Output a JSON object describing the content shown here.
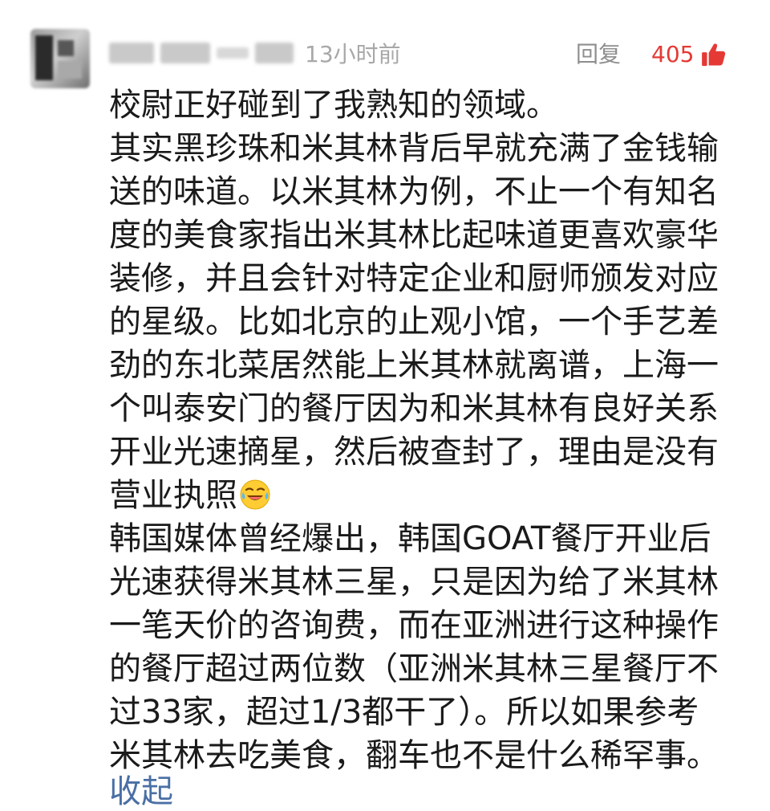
{
  "comment": {
    "time": "13小时前",
    "reply_label": "回复",
    "like_count": "405",
    "lines": [
      "校尉正好碰到了我熟知的领域。",
      "其实黑珍珠和米其林背后早就充满了金钱输",
      "送的味道。以米其林为例，不止一个有知名",
      "度的美食家指出米其林比起味道更喜欢豪华",
      "装修，并且会针对特定企业和厨师颁发对应",
      "的星级。比如北京的止观小馆，一个手艺差",
      "劲的东北菜居然能上米其林就离谱，上海一",
      "个叫泰安门的餐厅因为和米其林有良好关系",
      "开业光速摘星，然后被查封了，理由是没有",
      "营业执照",
      "韩国媒体曾经爆出，韩国GOAT餐厅开业后",
      "光速获得米其林三星，只是因为给了米其林",
      "一笔天价的咨询费，而在亚洲进行这种操作",
      "的餐厅超过两位数（亚洲米其林三星餐厅不",
      "过33家，超过1/3都干了）。所以如果参考",
      "米其林去吃美食，翻车也不是什么稀罕事。"
    ],
    "collapse_label": "收起",
    "colors": {
      "like": "#e53935",
      "link": "#4a6fa5",
      "text": "#1a1a1a",
      "meta": "#a8a8a8"
    },
    "icons": {
      "like": "thumbs-up-icon",
      "emoji": "crying-laughing-emoji-icon"
    }
  }
}
